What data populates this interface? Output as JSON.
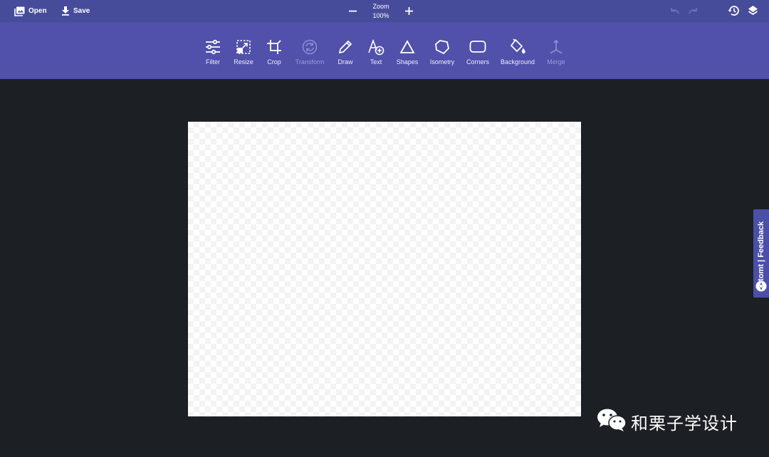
{
  "topbar": {
    "open_label": "Open",
    "save_label": "Save",
    "zoom_label": "Zoom",
    "zoom_value": "100%",
    "icons": {
      "open": "image-icon",
      "save": "download-icon",
      "zoom_out": "minus-icon",
      "zoom_in": "plus-icon",
      "undo": "undo-icon",
      "redo": "redo-icon",
      "history": "history-icon",
      "layers": "layers-icon"
    }
  },
  "toolbar": {
    "tools": [
      {
        "label": "Filter",
        "icon": "sliders-icon",
        "enabled": true
      },
      {
        "label": "Resize",
        "icon": "resize-icon",
        "enabled": true
      },
      {
        "label": "Crop",
        "icon": "crop-icon",
        "enabled": true
      },
      {
        "label": "Transform",
        "icon": "rotate-icon",
        "enabled": false
      },
      {
        "label": "Draw",
        "icon": "pencil-icon",
        "enabled": true
      },
      {
        "label": "Text",
        "icon": "text-add-icon",
        "enabled": true
      },
      {
        "label": "Shapes",
        "icon": "triangle-icon",
        "enabled": true
      },
      {
        "label": "Isometry",
        "icon": "pentagon-icon",
        "enabled": true
      },
      {
        "label": "Corners",
        "icon": "rounded-rect-icon",
        "enabled": true
      },
      {
        "label": "Background",
        "icon": "paint-bucket-icon",
        "enabled": true
      },
      {
        "label": "Merge",
        "icon": "merge-icon",
        "enabled": false
      }
    ]
  },
  "feedback": {
    "label": "stomt | Feedback",
    "icon": "stomt-logo-icon"
  },
  "watermark": {
    "text": "和栗子学设计",
    "icon": "wechat-icon"
  },
  "colors": {
    "topbar": "#474c9a",
    "toolbar": "#5150ab",
    "workspace": "#1c1f23",
    "canvas": "#ffffff"
  }
}
